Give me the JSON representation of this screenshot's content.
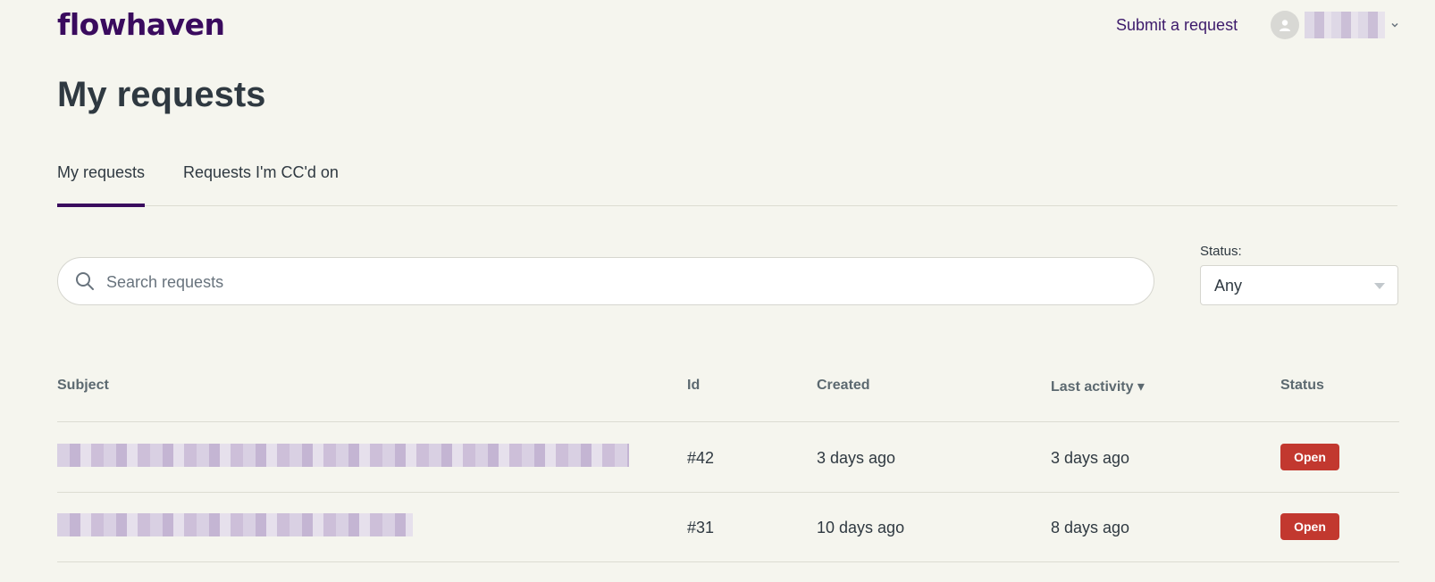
{
  "brand": {
    "logo_text": "flowhaven",
    "color": "#3a0b5e"
  },
  "header": {
    "submit_label": "Submit a request",
    "user_name": "",
    "avatar_icon": "user-icon",
    "menu_icon": "chevron-down-icon"
  },
  "page": {
    "title": "My requests"
  },
  "tabs": [
    {
      "label": "My requests",
      "active": true
    },
    {
      "label": "Requests I'm CC'd on",
      "active": false
    }
  ],
  "search": {
    "placeholder": "Search requests",
    "value": "",
    "icon": "search-icon"
  },
  "filter": {
    "label": "Status:",
    "selected": "Any"
  },
  "table": {
    "columns": {
      "subject": "Subject",
      "id": "Id",
      "created": "Created",
      "last_activity": "Last activity ▾",
      "status": "Status"
    },
    "rows": [
      {
        "subject": "",
        "id": "#42",
        "created": "3 days ago",
        "last_activity": "3 days ago",
        "status": "Open"
      },
      {
        "subject": "",
        "id": "#31",
        "created": "10 days ago",
        "last_activity": "8 days ago",
        "status": "Open"
      }
    ]
  },
  "colors": {
    "background": "#f5f5ee",
    "accent": "#3a0b5e",
    "status_open": "#c2382f"
  }
}
